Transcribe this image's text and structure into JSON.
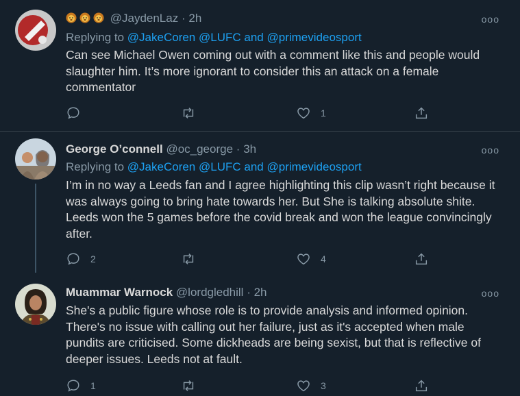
{
  "tweets": [
    {
      "name": "",
      "emojis": [
        "lion-face",
        "lion-face",
        "lion-face"
      ],
      "handle": "@JaydenLaz",
      "dot": "·",
      "time": "2h",
      "reply_prefix": "Replying to",
      "reply_to_1": "@JakeCoren",
      "reply_to_2": "@LUFC",
      "reply_and": "and",
      "reply_to_3": "@primevideosport",
      "text": "Can see Michael Owen coming out with a comment like this and people would slaughter him. It’s more ignorant to consider this an attack on a female commentator",
      "replies": "",
      "retweets": "",
      "likes": "1"
    },
    {
      "name": "George O’connell",
      "handle": "@oc_george",
      "dot": "·",
      "time": "3h",
      "reply_prefix": "Replying to",
      "reply_to_1": "@JakeCoren",
      "reply_to_2": "@LUFC",
      "reply_and": "and",
      "reply_to_3": "@primevideosport",
      "text": "I’m in no way a Leeds fan and I agree highlighting this clip wasn’t right because it was always going to bring hate towards her. But She is talking absolute shite. Leeds won the 5 games before the covid break and won the league convincingly after.",
      "replies": "2",
      "retweets": "",
      "likes": "4"
    },
    {
      "name": "Muammar Warnock",
      "handle": "@lordgledhill",
      "dot": "·",
      "time": "2h",
      "text": "She's a public figure whose role is to provide analysis and informed opinion. There's no issue with calling out her failure, just as it's accepted when male pundits are criticised. Some dickheads are being sexist, but that is reflective of deeper issues. Leeds not at fault.",
      "replies": "1",
      "retweets": "",
      "likes": "3"
    }
  ],
  "more_label": "ooo",
  "colors": {
    "background": "#15202b",
    "link": "#1da1f2",
    "muted": "#8899a6",
    "divider": "#38444d"
  }
}
